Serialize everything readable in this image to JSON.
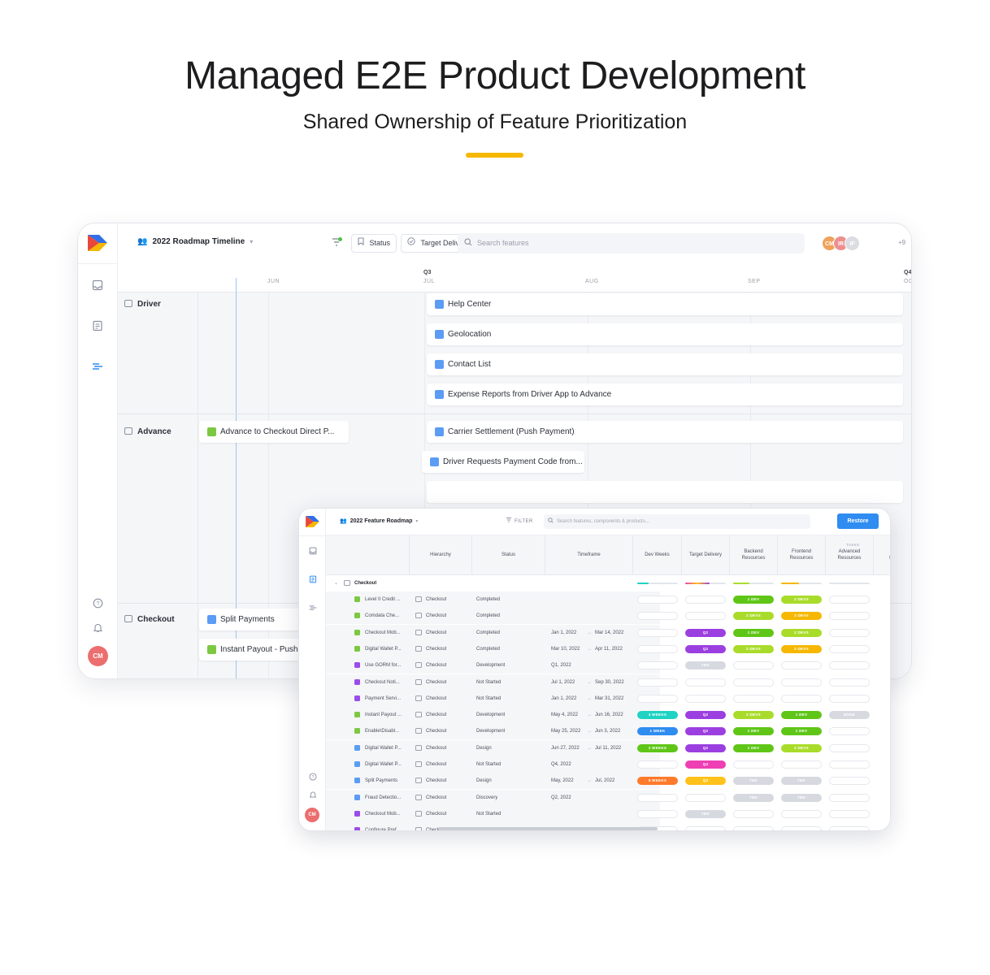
{
  "hero": {
    "title": "Managed E2E Product Development",
    "subtitle": "Shared Ownership of Feature Prioritization",
    "accent": "#f5b700"
  },
  "roadmap": {
    "title": "2022 Roadmap Timeline",
    "status_label": "Status",
    "target_label": "Target Delivery",
    "search_placeholder": "Search features",
    "avatars": [
      "CM",
      "IR",
      "IF"
    ],
    "more_count": "+9",
    "quarters": [
      "Q3",
      "Q4"
    ],
    "months": [
      "JUN",
      "JUL",
      "AUG",
      "SEP",
      "OC"
    ],
    "groups": [
      "Driver",
      "Advance",
      "Checkout"
    ],
    "bars": [
      {
        "label": "Help Center",
        "color": "#5b9cf5"
      },
      {
        "label": "Geolocation",
        "color": "#5b9cf5"
      },
      {
        "label": "Contact List",
        "color": "#5b9cf5"
      },
      {
        "label": "Expense Reports from Driver App to Advance",
        "color": "#5b9cf5"
      },
      {
        "label": "Advance to Checkout Direct P...",
        "color": "#7cc843"
      },
      {
        "label": "Carrier Settlement (Push Payment)",
        "color": "#5b9cf5"
      },
      {
        "label": "Driver Requests Payment Code from...",
        "color": "#5b9cf5"
      },
      {
        "label": "Split Payments",
        "color": "#5b9cf5"
      },
      {
        "label": "Instant Payout - Push",
        "color": "#7cc843"
      }
    ],
    "user_avatar": "CM"
  },
  "feature_table": {
    "title": "2022 Feature Roadmap",
    "filter_label": "FILTER",
    "search_placeholder": "Search features, components & products...",
    "restore_label": "Restore",
    "tasks_label": "TASKS",
    "columns": [
      "Hierarchy",
      "Status",
      "Timeframe",
      "Dev Weeks",
      "Target Delivery",
      "Backend Resources",
      "Frontend Resources",
      "Advanced Resources",
      "Pl Re"
    ],
    "group": "Checkout",
    "user_avatar": "CM",
    "rows": [
      {
        "name": "Level II Credit ...",
        "color": "#7cc843",
        "hier": "Checkout",
        "status": "Completed",
        "start": "",
        "end": "",
        "dev": "",
        "target": "",
        "backend": "1 DEV",
        "frontend": "2 DEVS",
        "advanced": ""
      },
      {
        "name": "Comdata Che...",
        "color": "#7cc843",
        "hier": "Checkout",
        "status": "Completed",
        "start": "",
        "end": "",
        "dev": "",
        "target": "",
        "backend": "2 DEVS",
        "frontend": "3 DEVS",
        "advanced": ""
      },
      {
        "name": "Checkout Mob...",
        "color": "#7cc843",
        "hier": "Checkout",
        "status": "Completed",
        "start": "Jan 1, 2022",
        "end": "Mar 14, 2022",
        "dev": "",
        "target": "Q2",
        "backend": "1 DEV",
        "frontend": "2 DEVS",
        "advanced": ""
      },
      {
        "name": "Digital Wallet P...",
        "color": "#7cc843",
        "hier": "Checkout",
        "status": "Completed",
        "start": "Mar 10, 2022",
        "end": "Apr 11, 2022",
        "dev": "",
        "target": "Q2",
        "backend": "2 DEVS",
        "frontend": "3 DEVS",
        "advanced": ""
      },
      {
        "name": "Use GORM for...",
        "color": "#9b4de8",
        "hier": "Checkout",
        "status": "Development",
        "start": "Q1, 2022",
        "end": "",
        "dev": "",
        "target": "TBD",
        "backend": "",
        "frontend": "",
        "advanced": ""
      },
      {
        "name": "Checkout Noti...",
        "color": "#9b4de8",
        "hier": "Checkout",
        "status": "Not Started",
        "start": "Jul 1, 2022",
        "end": "Sep 30, 2022",
        "dev": "",
        "target": "",
        "backend": "",
        "frontend": "",
        "advanced": ""
      },
      {
        "name": "Payment Servi...",
        "color": "#9b4de8",
        "hier": "Checkout",
        "status": "Not Started",
        "start": "Jan 1, 2022",
        "end": "Mar 31, 2022",
        "dev": "",
        "target": "",
        "backend": "",
        "frontend": "",
        "advanced": ""
      },
      {
        "name": "Instant Payout ...",
        "color": "#7cc843",
        "hier": "Checkout",
        "status": "Development",
        "start": "May 4, 2022",
        "end": "Jun 16, 2022",
        "dev": "4 WEEKS",
        "target": "Q2",
        "backend": "2 DEVS",
        "frontend": "1 DEV",
        "advanced": "NONE"
      },
      {
        "name": "Enable\\Disabl...",
        "color": "#7cc843",
        "hier": "Checkout",
        "status": "Development",
        "start": "May 25, 2022",
        "end": "Jun 3, 2022",
        "dev": "1 WEEK",
        "target": "Q2",
        "backend": "1 DEV",
        "frontend": "1 DEV",
        "advanced": ""
      },
      {
        "name": "Digital Wallet P...",
        "color": "#5b9cf5",
        "hier": "Checkout",
        "status": "Design",
        "start": "Jun 27, 2022",
        "end": "Jul 11, 2022",
        "dev": "2 WEEKS",
        "target": "Q2",
        "backend": "1 DEV",
        "frontend": "2 DEVS",
        "advanced": ""
      },
      {
        "name": "Digital Wallet P...",
        "color": "#5b9cf5",
        "hier": "Checkout",
        "status": "Not Started",
        "start": "Q4, 2022",
        "end": "",
        "dev": "",
        "target": "Q4",
        "backend": "",
        "frontend": "",
        "advanced": ""
      },
      {
        "name": "Split Payments",
        "color": "#5b9cf5",
        "hier": "Checkout",
        "status": "Design",
        "start": "May, 2022",
        "end": "Jul, 2022",
        "dev": "6 WEEKS",
        "target": "Q3",
        "backend": "TBD",
        "frontend": "TBD",
        "advanced": ""
      },
      {
        "name": "Fraud Detectio...",
        "color": "#5b9cf5",
        "hier": "Checkout",
        "status": "Discovery",
        "start": "Q2, 2022",
        "end": "",
        "dev": "",
        "target": "",
        "backend": "TBD",
        "frontend": "TBD",
        "advanced": ""
      },
      {
        "name": "Checkout Mob...",
        "color": "#9b4de8",
        "hier": "Checkout",
        "status": "Not Started",
        "start": "",
        "end": "",
        "dev": "",
        "target": "TBD",
        "backend": "",
        "frontend": "",
        "advanced": ""
      },
      {
        "name": "Configure Pref...",
        "color": "#9b4de8",
        "hier": "Checkout",
        "status": "Not Started",
        "start": "",
        "end": "",
        "dev": "",
        "target": "",
        "backend": "",
        "frontend": "",
        "advanced": ""
      }
    ],
    "pill_colors": {
      "1 DEV": "#5fc618",
      "2 DEVS": "#a9dc2a",
      "3 DEVS": "#f5b700",
      "Q2": "#9b3fe0",
      "Q3": "#ffc21a",
      "Q4": "#ee3fb4",
      "TBD": "#d6d9df",
      "4 WEEKS": "#1fd3c4",
      "1 WEEK": "#2f8cf1",
      "2 WEEKS": "#5fc618",
      "6 WEEKS": "#ff7a2a",
      "NONE": "#d6d9df"
    }
  }
}
